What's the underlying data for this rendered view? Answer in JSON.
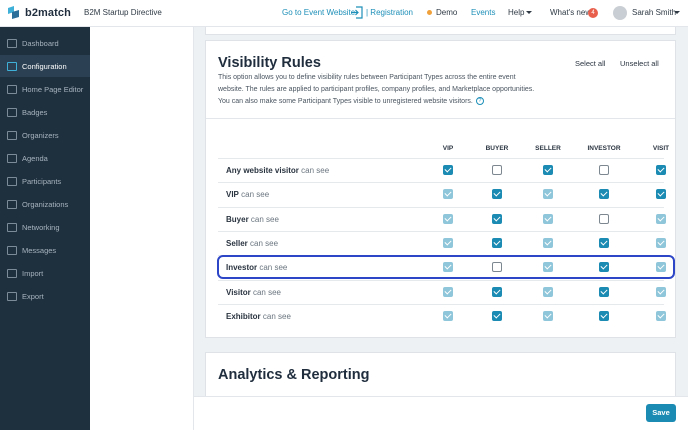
{
  "topbar": {
    "brand": "b2match",
    "event_name": "B2M Startup Directive",
    "go_to_event": "Go to Event Website",
    "registration": "| Registration",
    "demo": "Demo",
    "events": "Events",
    "help": "Help",
    "whats_new": "What's new",
    "whats_new_count": "4",
    "user_name": "Sarah Smith"
  },
  "sidebar": {
    "items": [
      {
        "label": "Dashboard",
        "icon": "dashboard-icon"
      },
      {
        "label": "Configuration",
        "icon": "wrench-icon",
        "active": true
      },
      {
        "label": "Home Page Editor",
        "icon": "page-icon"
      },
      {
        "label": "Badges",
        "icon": "badge-icon"
      },
      {
        "label": "Organizers",
        "icon": "people-icon"
      },
      {
        "label": "Agenda",
        "icon": "calendar-icon"
      },
      {
        "label": "Participants",
        "icon": "participants-icon"
      },
      {
        "label": "Organizations",
        "icon": "building-icon"
      },
      {
        "label": "Networking",
        "icon": "handshake-icon"
      },
      {
        "label": "Messages",
        "icon": "envelope-icon"
      },
      {
        "label": "Import",
        "icon": "import-icon"
      },
      {
        "label": "Export",
        "icon": "export-icon"
      }
    ]
  },
  "visibility": {
    "title": "Visibility Rules",
    "select_all": "Select all",
    "unselect_all": "Unselect all",
    "description": "This option allows you to define visibility rules between Participant Types across the entire event website. The rules are applied to participant profiles, company profiles, and Marketplace opportunities. You can also make some Participant Types visible to unregistered website visitors.",
    "help_glyph": "?",
    "columns": [
      "VIP",
      "BUYER",
      "SELLER",
      "INVESTOR",
      "VISIT"
    ],
    "can_see": "can see",
    "rows": [
      {
        "name": "Any website visitor",
        "values": [
          "on",
          "off",
          "on",
          "off",
          "on"
        ]
      },
      {
        "name": "VIP",
        "values": [
          "dim",
          "on",
          "dim",
          "on",
          "on"
        ]
      },
      {
        "name": "Buyer",
        "values": [
          "dim",
          "on",
          "dim",
          "off",
          "dim"
        ]
      },
      {
        "name": "Seller",
        "values": [
          "dim",
          "on",
          "dim",
          "on",
          "dim"
        ]
      },
      {
        "name": "Investor",
        "values": [
          "dim",
          "off",
          "dim",
          "on",
          "dim"
        ]
      },
      {
        "name": "Visitor",
        "values": [
          "dim",
          "on",
          "dim",
          "on",
          "dim"
        ]
      },
      {
        "name": "Exhibitor",
        "values": [
          "dim",
          "on",
          "dim",
          "on",
          "dim"
        ]
      }
    ]
  },
  "analytics": {
    "title": "Analytics & Reporting"
  },
  "footer": {
    "save": "Save"
  },
  "colors": {
    "accent": "#1b8bb3",
    "sidebar": "#1e2f3d",
    "highlight": "#2d46c7"
  }
}
